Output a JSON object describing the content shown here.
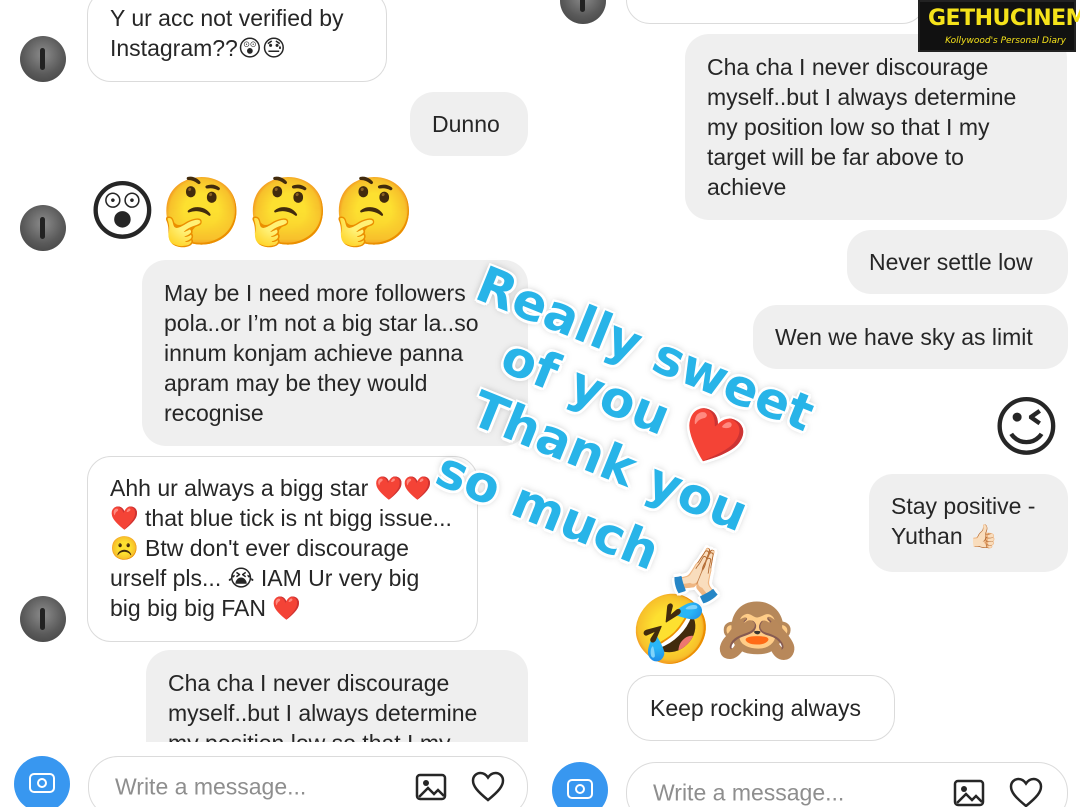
{
  "left_panel": {
    "messages": [
      {
        "type": "incoming",
        "text": "Y ur acc not verified by Instagram??😲😓"
      },
      {
        "type": "outgoing",
        "text": "Dunno"
      },
      {
        "type": "incoming_emoji",
        "text": "😲🤔🤔🤔"
      },
      {
        "type": "outgoing",
        "text": "May be I need more followers pola..or I’m not a big star la..so innum konjam achieve panna apram may be they would recognise"
      },
      {
        "type": "incoming",
        "text": "Ahh ur always a bigg star ❤️❤️❤️ that blue tick is nt bigg issue... ☹️ Btw don't ever discourage urself pls... 😭 IAM Ur very big big big big FAN ❤️"
      },
      {
        "type": "outgoing",
        "text": "Cha cha I never discourage myself..but I always determine my position low so that I my"
      }
    ],
    "composer": {
      "placeholder": "Write a message..."
    }
  },
  "right_panel": {
    "messages": [
      {
        "type": "outgoing",
        "text": "Cha cha I never discourage myself..but I always determine my position low so that I my target will be far above to achieve"
      },
      {
        "type": "outgoing",
        "text": "Never settle low"
      },
      {
        "type": "outgoing",
        "text": "Wen we have sky as limit"
      },
      {
        "type": "outgoing_emoji",
        "text": "😉"
      },
      {
        "type": "outgoing",
        "text": "Stay positive - Yuthan 👍🏻"
      },
      {
        "type": "incoming_emoji",
        "text": "🤣🙈"
      },
      {
        "type": "incoming",
        "text": "Keep rocking always"
      }
    ],
    "composer": {
      "placeholder": "Write a message..."
    }
  },
  "overlay": {
    "line1": "Really sweet",
    "line2": "of you ❤️",
    "line3": "Thank you",
    "line4": "so much 🙏🏻"
  },
  "watermark": {
    "name": "GETHUCINEMA",
    "tagline": "Kollywood's Personal Diary"
  },
  "colors": {
    "outgoing_bg": "#efefef",
    "incoming_border": "#dbdbdb",
    "camera_blue": "#3897f0",
    "overlay_text": "#28b4e8"
  }
}
